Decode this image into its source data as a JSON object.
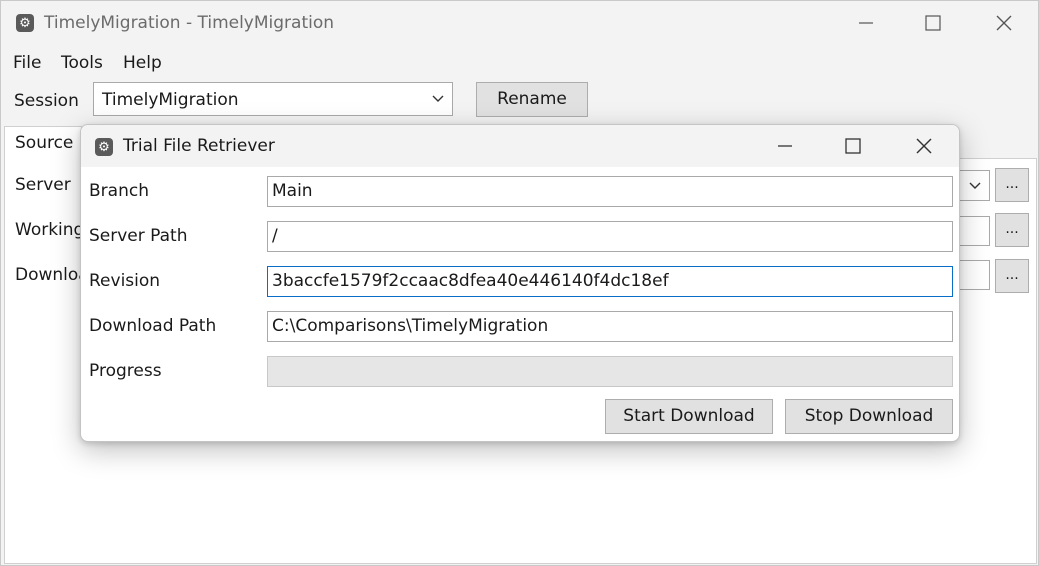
{
  "main_window": {
    "title": "TimelyMigration - TimelyMigration",
    "menu": {
      "file": "File",
      "tools": "Tools",
      "help": "Help"
    },
    "session_label": "Session",
    "session_value": "TimelyMigration",
    "rename_button": "Rename",
    "tab_source": "Source",
    "labels": {
      "server": "Server",
      "working": "Working",
      "download": "Downloa"
    },
    "browse_button": "..."
  },
  "dialog": {
    "title": "Trial File Retriever",
    "fields": {
      "branch_label": "Branch",
      "branch_value": "Main",
      "server_path_label": "Server Path",
      "server_path_value": "/",
      "revision_label": "Revision",
      "revision_value": "3baccfe1579f2ccaac8dfea40e446140f4dc18ef",
      "download_path_label": "Download Path",
      "download_path_value": "C:\\Comparisons\\TimelyMigration",
      "progress_label": "Progress"
    },
    "progress_value": 0,
    "start_button": "Start Download",
    "stop_button": "Stop Download"
  },
  "icons": {
    "app": "gear-icon",
    "minimize": "minimize-icon",
    "maximize": "maximize-icon",
    "close": "close-icon",
    "dropdown": "chevron-down-icon"
  },
  "colors": {
    "window_bg": "#f3f3f3",
    "focus_border": "#0a6ec8",
    "button_bg": "#e1e1e1",
    "progress_bg": "#e6e6e6"
  }
}
